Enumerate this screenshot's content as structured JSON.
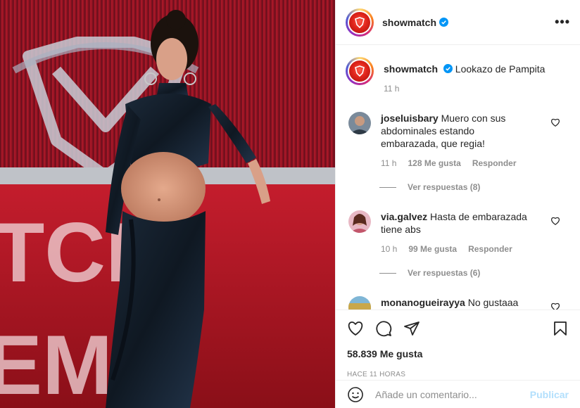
{
  "post": {
    "username": "showmatch",
    "more_icon": "more-options-icon",
    "photo_alt": "Post photo"
  },
  "caption": {
    "username": "showmatch",
    "text": "Lookazo de Pampita",
    "time": "11 h"
  },
  "comments": [
    {
      "username": "joseluisbary",
      "text": "Muero con sus abdominales estando embarazada, que regia!",
      "time": "11 h",
      "likes": "128 Me gusta",
      "reply_label": "Responder",
      "view_replies": "Ver respuestas (8)"
    },
    {
      "username": "via.galvez",
      "text": "Hasta de embarazada tiene abs",
      "time": "10 h",
      "likes": "99 Me gusta",
      "reply_label": "Responder",
      "view_replies": "Ver respuestas (6)"
    },
    {
      "username": "monanogueirayya",
      "text": "No gustaaa"
    }
  ],
  "actions": {
    "likes_count": "58.839 Me gusta",
    "time_ago": "Hace 11 horas"
  },
  "add_comment": {
    "placeholder": "Añade un comentario...",
    "publish_label": "Publicar"
  },
  "colors": {
    "verified": "#0095f6",
    "text": "#262626",
    "secondary": "#8e8e8e",
    "publish_disabled": "#b2dffc"
  }
}
